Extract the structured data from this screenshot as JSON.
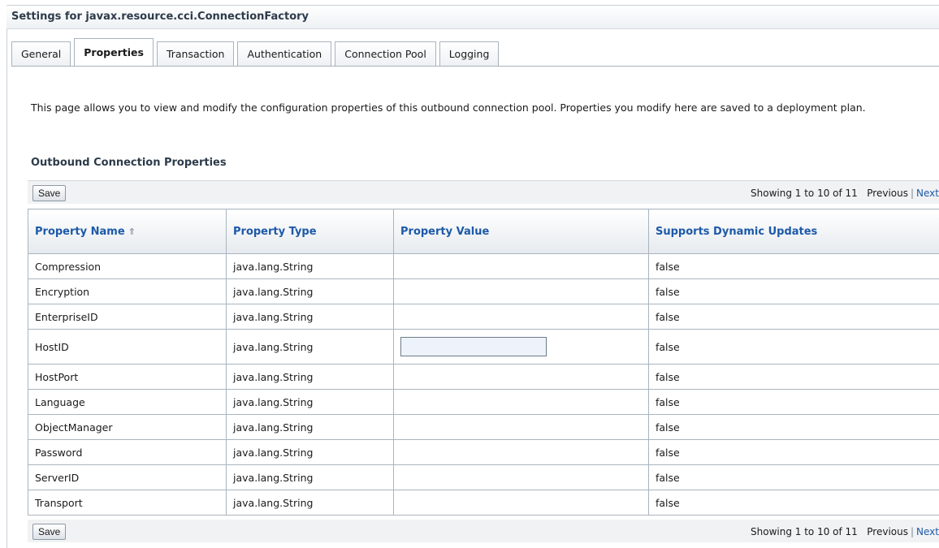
{
  "page": {
    "title": "Settings for javax.resource.cci.ConnectionFactory",
    "tabs": [
      "General",
      "Properties",
      "Transaction",
      "Authentication",
      "Connection Pool",
      "Logging"
    ],
    "active_tab": "Properties",
    "description": "This page allows you to view and modify the configuration properties of this outbound connection pool. Properties you modify here are saved to a deployment plan.",
    "section_title": "Outbound Connection Properties"
  },
  "toolbar": {
    "save_label": "Save",
    "showing": "Showing 1 to 10 of 11",
    "previous": "Previous",
    "separator": "|",
    "next": "Next"
  },
  "table": {
    "headers": [
      "Property Name",
      "Property Type",
      "Property Value",
      "Supports Dynamic Updates"
    ],
    "sort_icon": "sort-ascending-icon",
    "rows": [
      {
        "name": "Compression",
        "type": "java.lang.String",
        "value": "",
        "dynamic": "false"
      },
      {
        "name": "Encryption",
        "type": "java.lang.String",
        "value": "",
        "dynamic": "false"
      },
      {
        "name": "EnterpriseID",
        "type": "java.lang.String",
        "value": "",
        "dynamic": "false"
      },
      {
        "name": "HostID",
        "type": "java.lang.String",
        "value": "",
        "dynamic": "false"
      },
      {
        "name": "HostPort",
        "type": "java.lang.String",
        "value": "",
        "dynamic": "false"
      },
      {
        "name": "Language",
        "type": "java.lang.String",
        "value": "",
        "dynamic": "false"
      },
      {
        "name": "ObjectManager",
        "type": "java.lang.String",
        "value": "",
        "dynamic": "false"
      },
      {
        "name": "Password",
        "type": "java.lang.String",
        "value": "",
        "dynamic": "false"
      },
      {
        "name": "ServerID",
        "type": "java.lang.String",
        "value": "",
        "dynamic": "false"
      },
      {
        "name": "Transport",
        "type": "java.lang.String",
        "value": "",
        "dynamic": "false"
      }
    ]
  },
  "colors": {
    "link": "#1d59a8",
    "header_text": "#1d59a8",
    "border": "#aab5bf",
    "input_bg": "#eef3fb"
  }
}
